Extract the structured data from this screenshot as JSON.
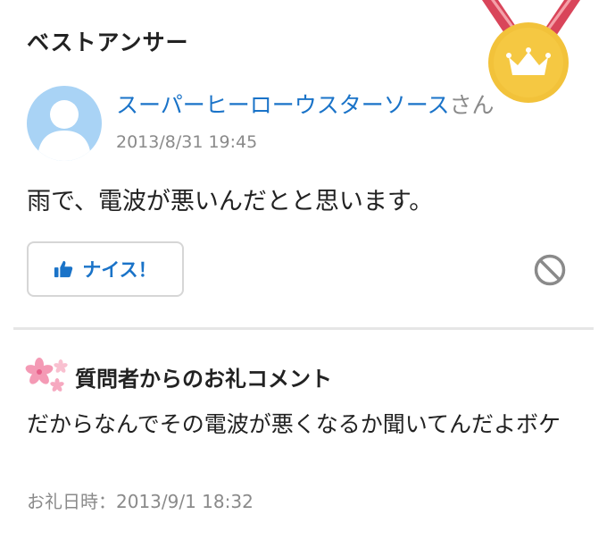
{
  "best_answer": {
    "section_title": "ベストアンサー",
    "medal_icon": "crown-medal-icon",
    "author": {
      "avatar_icon": "default-user-avatar-icon",
      "name": "スーパーヒーローウスターソース",
      "honorific": "さん"
    },
    "date": "2013/8/31 19:45",
    "body": "雨で、電波が悪いんだとと思います。",
    "nice_button": {
      "icon": "thumbs-up-icon",
      "label": "ナイス！"
    },
    "report_icon": "prohibit-icon"
  },
  "thanks_comment": {
    "icon": "sakura-icon",
    "title": "質問者からのお礼コメント",
    "body": "だからなんでその電波が悪くなるか聞いてんだよボケ",
    "date_label": "お礼日時：",
    "date": "2013/9/1 18:32"
  },
  "colors": {
    "link_blue": "#1a73c8",
    "muted_gray": "#8a8a8a",
    "medal_gold": "#f2c23a",
    "ribbon_red": "#d9455a",
    "avatar_blue": "#a9d3f5"
  }
}
